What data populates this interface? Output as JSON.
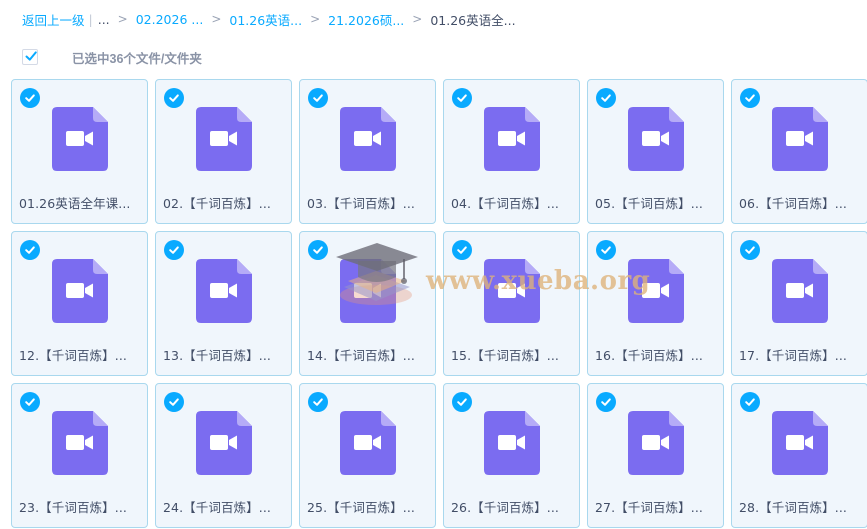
{
  "breadcrumb": {
    "back": "返回上一级",
    "pipe": "|",
    "ellipsis": "...",
    "items": [
      "02.2026 ...",
      "01.26英语...",
      "21.2026硕...",
      "01.26英语全..."
    ]
  },
  "selection": {
    "label": "已选中36个文件/文件夹",
    "checked": true
  },
  "files": [
    {
      "name": "01.26英语全年课..."
    },
    {
      "name": "02.【千词百炼】..."
    },
    {
      "name": "03.【千词百炼】..."
    },
    {
      "name": "04.【千词百炼】..."
    },
    {
      "name": "05.【千词百炼】..."
    },
    {
      "name": "06.【千词百炼】..."
    },
    {
      "name": "12.【千词百炼】..."
    },
    {
      "name": "13.【千词百炼】..."
    },
    {
      "name": "14.【千词百炼】..."
    },
    {
      "name": "15.【千词百炼】..."
    },
    {
      "name": "16.【千词百炼】..."
    },
    {
      "name": "17.【千词百炼】..."
    },
    {
      "name": "23.【千词百炼】..."
    },
    {
      "name": "24.【千词百炼】..."
    },
    {
      "name": "25.【千词百炼】..."
    },
    {
      "name": "26.【千词百炼】..."
    },
    {
      "name": "27.【千词百炼】..."
    },
    {
      "name": "28.【千词百炼】..."
    }
  ],
  "watermark": {
    "text": "www.xueba.org"
  },
  "colors": {
    "accent": "#09AAFF",
    "video_icon": "#7B6CF0",
    "video_icon_fold": "#B5ABF7",
    "card_bg": "#f0f6fc",
    "card_border": "#a9d8ee"
  }
}
